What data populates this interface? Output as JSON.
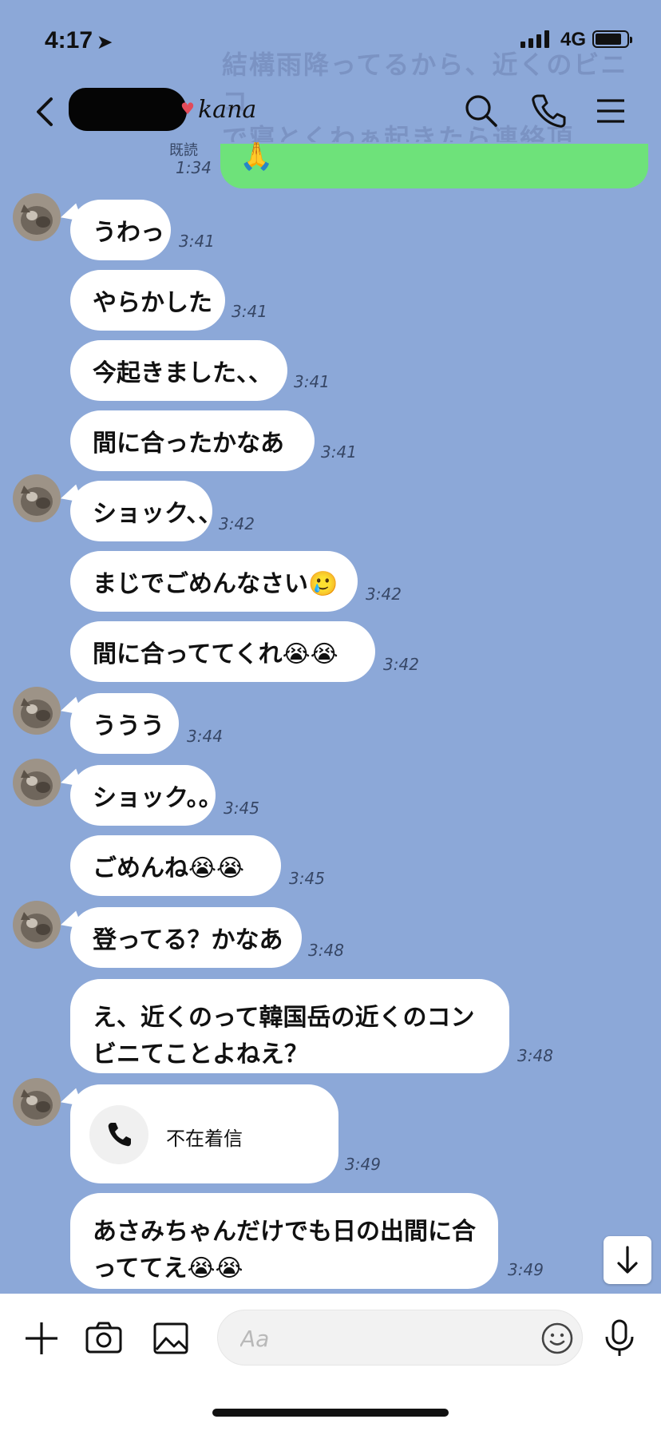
{
  "status_bar": {
    "time": "4:17",
    "network": "4G"
  },
  "header": {
    "chat_name": "kana"
  },
  "background_hint": {
    "ghost_text": "結構雨降ってるから、近くのビニコ\nで寝とくわぁ起きたら連絡頂"
  },
  "previous": {
    "read_label": "既読",
    "time": "1:34",
    "emoji": "🙏"
  },
  "messages": [
    {
      "text": "うわっ",
      "time": "3:41"
    },
    {
      "text": "やらかした",
      "time": "3:41"
    },
    {
      "text": "今起きました、、",
      "time": "3:41"
    },
    {
      "text": "間に合ったかなあ",
      "time": "3:41"
    },
    {
      "text": "ショック、、",
      "time": "3:42"
    },
    {
      "text": "まじでごめんなさい🥲",
      "time": "3:42"
    },
    {
      "text": "間に合っててくれ😭😭",
      "time": "3:42"
    },
    {
      "text": "ううう",
      "time": "3:44"
    },
    {
      "text": "ショック。。",
      "time": "3:45"
    },
    {
      "text": "ごめんね😭😭",
      "time": "3:45"
    },
    {
      "text": "登ってる？かなあ",
      "time": "3:48"
    },
    {
      "text": "え、近くのって韓国岳の近くのコンビニてことよねえ？",
      "time": "3:48"
    },
    {
      "text": "不在着信",
      "time": "3:49"
    },
    {
      "text": "あさみちゃんだけでも日の出間に合っててえ😭😭",
      "time": "3:49"
    }
  ],
  "composer": {
    "placeholder": "Aa"
  },
  "icons": {
    "back": "chevron-left-icon",
    "search": "search-icon",
    "call": "phone-icon",
    "menu": "menu-icon",
    "plus": "plus-icon",
    "camera": "camera-icon",
    "image": "image-icon",
    "emoji": "emoji-icon",
    "mic": "microphone-icon",
    "scroll": "arrow-down-icon"
  },
  "colors": {
    "chat_background": "#8ca8d8",
    "own_bubble": "#6ee27a",
    "other_bubble": "#ffffff"
  },
  "battery_level": 0.85
}
